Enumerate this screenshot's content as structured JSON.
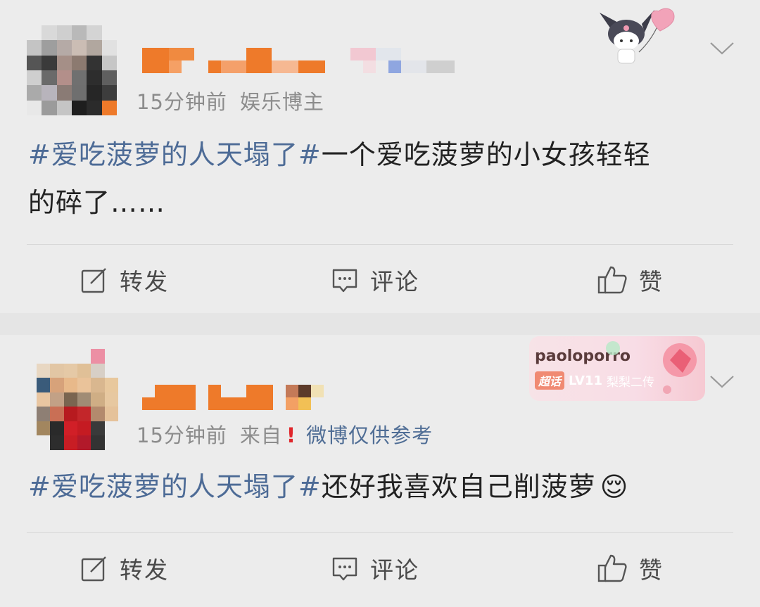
{
  "posts": [
    {
      "time": "15分钟前",
      "meta_extra": "娱乐博主",
      "hashtag": "#爱吃菠萝的人天塌了#",
      "text_line1": "一个爱吃菠萝的小女孩轻轻",
      "text_line2": "的碎了……",
      "actions": {
        "repost": "转发",
        "comment": "评论",
        "like": "赞"
      }
    },
    {
      "time": "15分钟前",
      "meta_from": "来自",
      "warning": "!",
      "source": "微博仅供参考",
      "hashtag": "#爱吃菠萝的人天塌了#",
      "text": "还好我喜欢自己削菠萝",
      "emoji": "😌",
      "badge": {
        "title": "paoloporro",
        "chaohua": "超话",
        "level": "LV11",
        "role": "梨梨二传"
      },
      "actions": {
        "repost": "转发",
        "comment": "评论",
        "like": "赞"
      }
    }
  ],
  "colors": {
    "hashtag": "#4d6b96",
    "background": "#ececec",
    "separator": "#e5e5e5",
    "name_blur": "#ee7a2a"
  },
  "icons": [
    "edit-icon",
    "comment-icon",
    "thumbs-up-icon",
    "chevron-down-icon",
    "kuromi-balloon-sticker",
    "super-topic-badge"
  ]
}
